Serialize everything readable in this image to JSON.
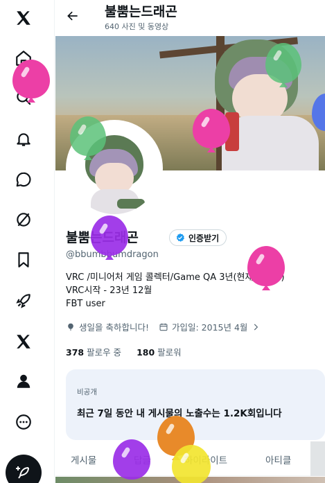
{
  "nav": {
    "items": [
      {
        "name": "x-logo-icon"
      },
      {
        "name": "home-icon"
      },
      {
        "name": "search-icon"
      },
      {
        "name": "notifications-icon"
      },
      {
        "name": "messages-icon"
      },
      {
        "name": "grok-icon"
      },
      {
        "name": "bookmarks-icon"
      },
      {
        "name": "rocket-icon"
      },
      {
        "name": "premium-x-icon"
      },
      {
        "name": "profile-icon"
      },
      {
        "name": "more-icon"
      }
    ],
    "post_icon": "feather-plus-icon"
  },
  "header": {
    "title": "불뿜는드래곤",
    "subtitle": "640 사진 및 동영상"
  },
  "profile": {
    "display_name": "불뿜는드래곤",
    "verify_label": "인증받기",
    "handle": "@bbumbbumdragon",
    "bio": [
      "VRC /미니어처 게임 콜렉터/Game QA 3년(현재 구직중)",
      "VRC시작 - 23년 12월",
      "FBT user"
    ],
    "birthday": "생일을 축하합니다!",
    "joined": "가입일: 2015년 4월",
    "following_count": "378",
    "following_label": "팔로우 중",
    "followers_count": "180",
    "followers_label": "팔로워"
  },
  "insight": {
    "tag": "비공개",
    "message": "최근 7일 동안 내 게시물의 노출수는 1.2K회입니다"
  },
  "tabs": [
    "게시물",
    "답글",
    "하이라이트",
    "아티클"
  ],
  "colors": {
    "accent": "#1d9bf0",
    "verified": "#1d9bf0",
    "card_bg": "#edf2fa",
    "balloon_pink": "#ec3fa6",
    "balloon_green": "#5cc27a",
    "balloon_purple": "#9b2ee8",
    "balloon_orange": "#e88a2a",
    "balloon_yellow": "#f2e530",
    "balloon_blue": "#5576e8"
  }
}
